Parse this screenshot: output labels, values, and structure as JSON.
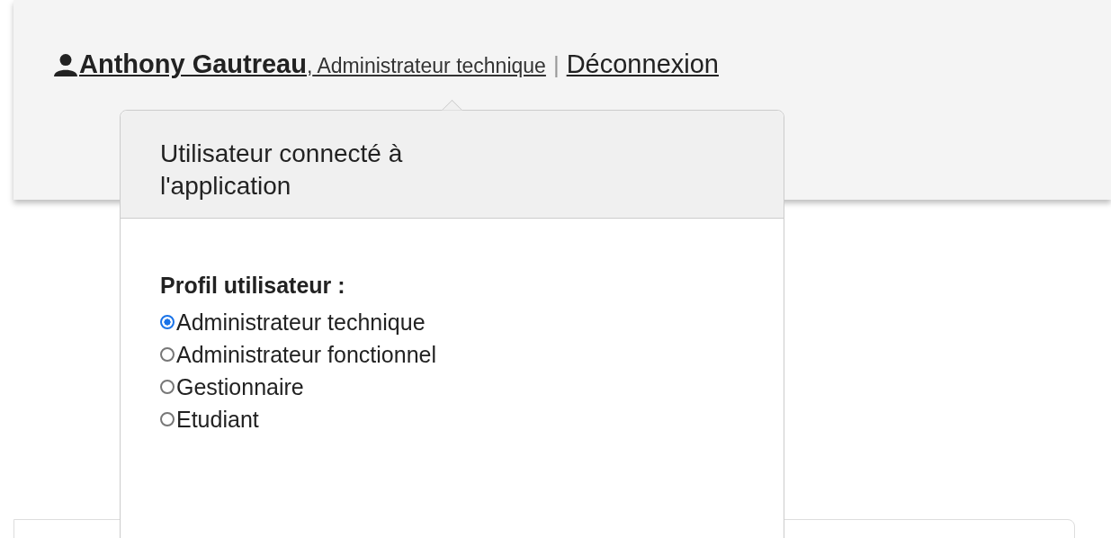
{
  "user": {
    "name": "Anthony Gautreau",
    "separator": ",",
    "role": "Administrateur technique",
    "divider": "|",
    "logout": "Déconnexion"
  },
  "popover": {
    "title": "Utilisateur connecté à l'application",
    "profile_label": "Profil utilisateur :",
    "profiles": [
      {
        "label": "Administrateur technique",
        "selected": true
      },
      {
        "label": "Administrateur fonctionnel",
        "selected": false
      },
      {
        "label": "Gestionnaire",
        "selected": false
      },
      {
        "label": "Etudiant",
        "selected": false
      }
    ]
  }
}
